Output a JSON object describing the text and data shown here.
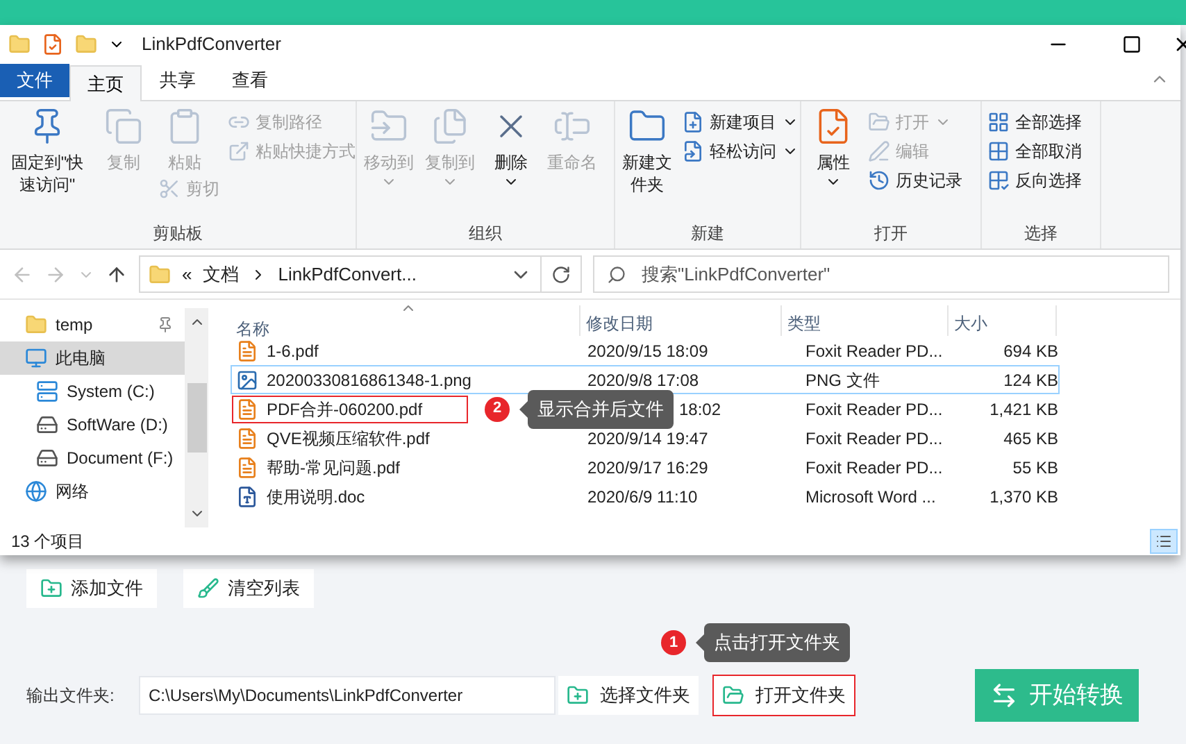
{
  "window": {
    "title": "LinkPdfConverter"
  },
  "ribbon_tabs": [
    {
      "label": "文件",
      "kind": "file",
      "selected": false
    },
    {
      "label": "主页",
      "kind": "tab",
      "selected": true
    },
    {
      "label": "共享",
      "kind": "tab",
      "selected": false
    },
    {
      "label": "查看",
      "kind": "tab",
      "selected": false
    }
  ],
  "ribbon_groups": [
    {
      "label": "剪贴板",
      "columns": [
        [
          {
            "label": "固定到\"快速访问\"",
            "kind": "large",
            "disabled": false,
            "dropdown": false
          }
        ],
        [
          {
            "label": "复制",
            "kind": "large",
            "disabled": true,
            "dropdown": false
          }
        ],
        [
          {
            "label": "粘贴",
            "kind": "large",
            "disabled": true,
            "dropdown": false
          },
          {
            "label": "剪切",
            "kind": "small",
            "disabled": true,
            "dropdown": false
          }
        ],
        [
          {
            "label": "复制路径",
            "kind": "small",
            "disabled": true,
            "dropdown": false
          },
          {
            "label": "粘贴快捷方式",
            "kind": "small",
            "disabled": true,
            "dropdown": false
          }
        ]
      ]
    },
    {
      "label": "组织",
      "columns": [
        [
          {
            "label": "移动到",
            "kind": "large",
            "disabled": true,
            "dropdown": true
          }
        ],
        [
          {
            "label": "复制到",
            "kind": "large",
            "disabled": true,
            "dropdown": true
          }
        ],
        [
          {
            "label": "删除",
            "kind": "large",
            "disabled": false,
            "dropdown": true
          }
        ],
        [
          {
            "label": "重命名",
            "kind": "large",
            "disabled": true,
            "dropdown": false
          }
        ]
      ]
    },
    {
      "label": "新建",
      "columns": [
        [
          {
            "label": "新建文件夹",
            "kind": "large",
            "disabled": false,
            "dropdown": false
          }
        ],
        [
          {
            "label": "新建项目",
            "kind": "small",
            "disabled": false,
            "dropdown": true
          },
          {
            "label": "轻松访问",
            "kind": "small",
            "disabled": false,
            "dropdown": true
          }
        ]
      ]
    },
    {
      "label": "打开",
      "columns": [
        [
          {
            "label": "属性",
            "kind": "large",
            "disabled": false,
            "dropdown": true
          }
        ],
        [
          {
            "label": "打开",
            "kind": "small",
            "disabled": true,
            "dropdown": true
          },
          {
            "label": "编辑",
            "kind": "small",
            "disabled": true,
            "dropdown": false
          },
          {
            "label": "历史记录",
            "kind": "small",
            "disabled": false,
            "dropdown": false
          }
        ]
      ]
    },
    {
      "label": "选择",
      "columns": [
        [
          {
            "label": "全部选择",
            "kind": "small",
            "disabled": false,
            "dropdown": false
          },
          {
            "label": "全部取消",
            "kind": "small",
            "disabled": false,
            "dropdown": false
          },
          {
            "label": "反向选择",
            "kind": "small",
            "disabled": false,
            "dropdown": false
          }
        ]
      ]
    }
  ],
  "address_bar": {
    "crumbs": [
      "«",
      "文档",
      "LinkPdfConvert..."
    ]
  },
  "search": {
    "placeholder": "搜索\"LinkPdfConverter\""
  },
  "nav_pane": [
    {
      "label": "temp",
      "kind": "folder",
      "pinned": true,
      "selected": false
    },
    {
      "label": "此电脑",
      "kind": "pc",
      "pinned": false,
      "selected": true,
      "children": [
        {
          "label": "System (C:)",
          "kind": "system",
          "pinned": false,
          "selected": false
        },
        {
          "label": "SoftWare (D:)",
          "kind": "drive",
          "pinned": false,
          "selected": false
        },
        {
          "label": "Document (F:)",
          "kind": "drive",
          "pinned": false,
          "selected": false
        }
      ]
    },
    {
      "label": "网络",
      "kind": "network",
      "pinned": false,
      "selected": false
    }
  ],
  "file_list": {
    "columns": [
      {
        "label": "名称",
        "sorted": true
      },
      {
        "label": "修改日期",
        "sorted": false
      },
      {
        "label": "类型",
        "sorted": false
      },
      {
        "label": "大小",
        "sorted": false
      }
    ],
    "rows": [
      {
        "kind": "pdf",
        "name": "1-6.pdf",
        "date": "2020/9/15 18:09",
        "type": "Foxit Reader PD...",
        "size": "694 KB",
        "selected": false,
        "highlighted": false
      },
      {
        "kind": "png",
        "name": "20200330816861348-1.png",
        "date": "2020/9/8 17:08",
        "type": "PNG 文件",
        "size": "124 KB",
        "selected": true,
        "highlighted": false
      },
      {
        "kind": "pdf",
        "name": "PDF合并-060200.pdf",
        "date": "18:02",
        "type": "Foxit Reader PD...",
        "size": "1,421 KB",
        "selected": false,
        "highlighted": true
      },
      {
        "kind": "pdf",
        "name": "QVE视频压缩软件.pdf",
        "date": "2020/9/14 19:47",
        "type": "Foxit Reader PD...",
        "size": "465 KB",
        "selected": false,
        "highlighted": false
      },
      {
        "kind": "pdf",
        "name": "帮助-常见问题.pdf",
        "date": "2020/9/17 16:29",
        "type": "Foxit Reader PD...",
        "size": "55 KB",
        "selected": false,
        "highlighted": false
      },
      {
        "kind": "doc",
        "name": "使用说明.doc",
        "date": "2020/6/9 11:10",
        "type": "Microsoft Word ...",
        "size": "1,370 KB",
        "selected": false,
        "highlighted": false
      }
    ]
  },
  "status_bar": {
    "count": "13 个项目"
  },
  "callouts": [
    {
      "number": "2",
      "text": "显示合并后文件"
    },
    {
      "number": "1",
      "text": "点击打开文件夹"
    }
  ],
  "app": {
    "buttons": [
      "添加文件",
      "清空列表"
    ],
    "output_label": "输出文件夹:",
    "output_path": "C:\\Users\\My\\Documents\\LinkPdfConverter",
    "choose_button": "选择文件夹",
    "open_button": {
      "label": "打开文件夹",
      "highlighted": true
    },
    "start_button": "开始转换"
  }
}
